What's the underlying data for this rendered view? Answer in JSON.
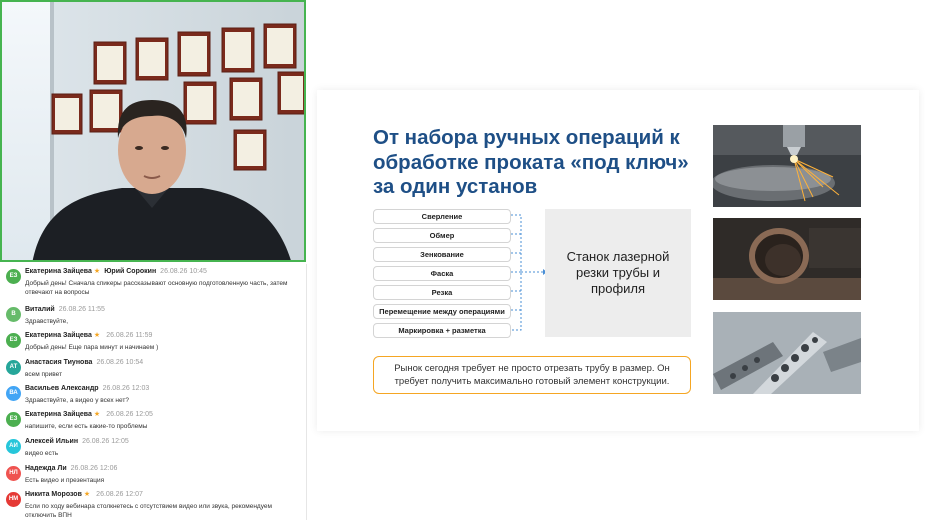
{
  "chat": {
    "messages": [
      {
        "initials": "ЕЗ",
        "avatar_color": "#4caf50",
        "name": "Екатерина Зайцева",
        "star": "★",
        "to": "Юрий Сорокин",
        "time": "26.08.26 10:45",
        "text": "Добрый день! Сначала спикеры рассказывают основную подготовленную часть, затем отвечают на вопросы"
      },
      {
        "initials": "В",
        "avatar_color": "#66bb6a",
        "name": "Виталий",
        "time": "26.08.26 11:55",
        "text": "Здравствуйте,"
      },
      {
        "initials": "ЕЗ",
        "avatar_color": "#4caf50",
        "name": "Екатерина Зайцева",
        "star": "★",
        "time": "26.08.26 11:59",
        "text": "Добрый день! Еще пара минут и начинаем )"
      },
      {
        "initials": "АТ",
        "avatar_color": "#26a69a",
        "name": "Анастасия Тиунова",
        "time": "26.08.26 10:54",
        "text": "всем привет"
      },
      {
        "initials": "ВА",
        "avatar_color": "#42a5f5",
        "name": "Васильев Александр",
        "time": "26.08.26 12:03",
        "text": "Здравствуйте, а видео у всех нет?"
      },
      {
        "initials": "ЕЗ",
        "avatar_color": "#4caf50",
        "name": "Екатерина Зайцева",
        "star": "★",
        "time": "26.08.26 12:05",
        "text": "напишите, если есть какие-то проблемы"
      },
      {
        "initials": "АИ",
        "avatar_color": "#26c6da",
        "name": "Алексей Ильин",
        "time": "26.08.26 12:05",
        "text": "видео есть"
      },
      {
        "initials": "НЛ",
        "avatar_color": "#ef5350",
        "name": "Надежда Ли",
        "time": "26.08.26 12:06",
        "text": "Есть видео и презентация"
      },
      {
        "initials": "НМ",
        "avatar_color": "#e53935",
        "name": "Никита Морозов",
        "star": "★",
        "time": "26.08.26 12:07",
        "text": "Если по ходу вебинара столкнетесь с отсутствием видео или звука, рекомендуем отключить ВПН"
      }
    ]
  },
  "slide": {
    "title": "От набора ручных операций к обработке проката «под ключ» за один установ",
    "operations": [
      "Сверление",
      "Обмер",
      "Зенкование",
      "Фаска",
      "Резка",
      "Перемещение между операциями",
      "Маркировка + разметка"
    ],
    "machine": "Станок лазерной резки трубы и профиля",
    "callout": "Рынок сегодня требует не просто отрезать трубу в размер. Он требует получить максимально готовый элемент конструкции.",
    "photos": [
      "laser-cutting-photo",
      "pipe-end-photo",
      "cut-profile-photo"
    ]
  },
  "colors": {
    "title": "#1e4f86",
    "video_border": "#46b450",
    "callout_border": "#f5a623",
    "connector": "#4a8fd6"
  }
}
